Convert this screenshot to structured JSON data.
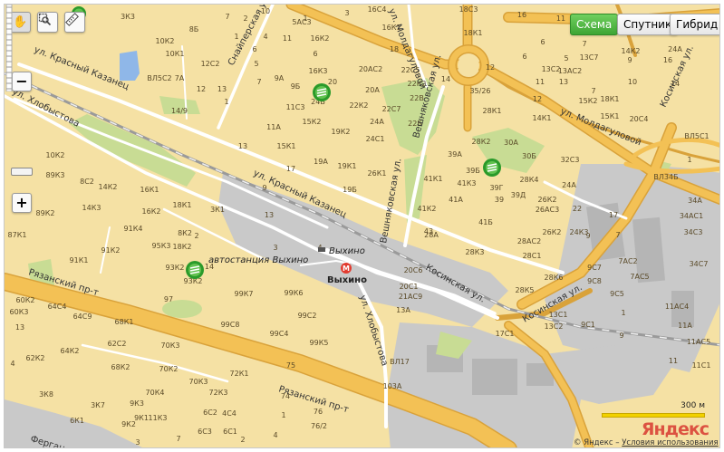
{
  "map_type_buttons": {
    "scheme": "Схема",
    "satellite": "Спутник",
    "hybrid": "Гибрид"
  },
  "toolbar": {
    "pan": "hand-icon",
    "magnifier": "magnifier-icon",
    "ruler": "ruler-icon"
  },
  "zoom": {
    "plus": "+",
    "minus": "−",
    "level_fraction": 0.17
  },
  "streets": {
    "sniperskaya": "Снайперская ул.",
    "moldagulovoy_top": "ул. Молдагуловой",
    "veshnyakovskaya_top": "Вешняковская ул.",
    "krasny_kazanets_upper": "ул. Красный Казанец",
    "khlobystova_upper": "ул. Хлобыстова",
    "moldagulovoy_right": "ул. Молдагуловой",
    "krasny_kazanets_mid": "ул. Красный Казанец",
    "veshnyakovskaya_mid": "Вешняковская ул.",
    "kosinskaya_mid": "Косинская ул.",
    "kosinskaya_right": "Косинская ул.",
    "kosinskaya_far": "Косинская ул.",
    "ryazansky_upper": "Рязанский пр-т",
    "ryazansky_lower": "Рязанский пр-т",
    "khlobystova_lower": "ул. Хлобыстова",
    "fergansky": "Ферган"
  },
  "places": {
    "bus_station": "автостанция Выхино",
    "metro_station": "Выхино",
    "rail_station": "Выхино"
  },
  "scale": {
    "label": "300 м"
  },
  "logo": "Яндекс",
  "copyright": {
    "prefix": "© Яндекс – ",
    "terms_link": "Условия использования"
  },
  "colors": {
    "base": "#f5e1a4",
    "major_road": "#f3c155",
    "road_casing": "#d9a23a",
    "minor_road": "#ffffff",
    "park": "#c8dc94",
    "water": "#8fb7e8",
    "industrial": "#c8c8c8",
    "railway": "#9a9a9a",
    "active_button": "#3fa534"
  },
  "house_numbers": [
    [
      "3К3",
      140,
      20
    ],
    [
      "7",
      250,
      20
    ],
    [
      "10",
      292,
      14
    ],
    [
      "2",
      270,
      22
    ],
    [
      "1",
      336,
      22
    ],
    [
      "5АС3",
      332,
      26
    ],
    [
      "3",
      382,
      16
    ],
    [
      "16С4",
      415,
      12
    ],
    [
      "18С3",
      516,
      12
    ],
    [
      "16",
      575,
      18
    ],
    [
      "11",
      618,
      22
    ],
    [
      "10К2",
      181,
      47
    ],
    [
      "8Б",
      213,
      34
    ],
    [
      "1",
      260,
      42
    ],
    [
      "4",
      292,
      42
    ],
    [
      "6",
      280,
      56
    ],
    [
      "11",
      316,
      44
    ],
    [
      "16К2",
      352,
      44
    ],
    [
      "16К1",
      431,
      32
    ],
    [
      "18К1",
      521,
      38
    ],
    [
      "7",
      644,
      50
    ],
    [
      "6",
      598,
      48
    ],
    [
      "14К2",
      695,
      58
    ],
    [
      "24А",
      744,
      56
    ],
    [
      "10К1",
      192,
      61
    ],
    [
      "12С2",
      231,
      72
    ],
    [
      "5",
      282,
      72
    ],
    [
      "6",
      347,
      61
    ],
    [
      "18",
      434,
      56
    ],
    [
      "6",
      578,
      64
    ],
    [
      "5",
      624,
      66
    ],
    [
      "13С2",
      607,
      78
    ],
    [
      "13АС2",
      628,
      80
    ],
    [
      "13С7",
      649,
      65
    ],
    [
      "9",
      694,
      68
    ],
    [
      "16",
      736,
      68
    ],
    [
      "ВЛ5С2",
      175,
      88
    ],
    [
      "7А",
      197,
      88
    ],
    [
      "7",
      285,
      92
    ],
    [
      "9А",
      307,
      88
    ],
    [
      "16К3",
      350,
      80
    ],
    [
      "20АС2",
      408,
      78
    ],
    [
      "22С5",
      452,
      79
    ],
    [
      "12",
      540,
      76
    ],
    [
      "11",
      595,
      92
    ],
    [
      "13",
      621,
      92
    ],
    [
      "10",
      697,
      92
    ],
    [
      "14",
      744,
      94
    ],
    [
      "12",
      221,
      100
    ],
    [
      "13",
      244,
      100
    ],
    [
      "9Б",
      325,
      97
    ],
    [
      "20",
      366,
      92
    ],
    [
      "22К2",
      459,
      94
    ],
    [
      "14",
      491,
      89
    ],
    [
      "35/26",
      529,
      102
    ],
    [
      "12",
      592,
      111
    ],
    [
      "7",
      654,
      102
    ],
    [
      "14/9",
      197,
      124
    ],
    [
      "1",
      249,
      114
    ],
    [
      "11С3",
      325,
      120
    ],
    [
      "24Б",
      350,
      114
    ],
    [
      "22К2",
      395,
      118
    ],
    [
      "20А",
      410,
      101
    ],
    [
      "22С7",
      431,
      122
    ],
    [
      "22В",
      459,
      110
    ],
    [
      "28К1",
      542,
      124
    ],
    [
      "15К2",
      648,
      113
    ],
    [
      "18К1",
      672,
      111
    ],
    [
      "11А",
      301,
      142
    ],
    [
      "15К2",
      343,
      136
    ],
    [
      "19К2",
      375,
      147
    ],
    [
      "24А",
      415,
      136
    ],
    [
      "22Б",
      457,
      138
    ],
    [
      "14К1",
      597,
      132
    ],
    [
      "15К1",
      672,
      130
    ],
    [
      "20С4",
      704,
      133
    ],
    [
      "13",
      267,
      163
    ],
    [
      "15К1",
      315,
      163
    ],
    [
      "24С1",
      413,
      155
    ],
    [
      "28К2",
      530,
      158
    ],
    [
      "30А",
      563,
      159
    ],
    [
      "ВЛ5С1",
      768,
      152
    ],
    [
      "1",
      760,
      178
    ],
    [
      "19А",
      353,
      180
    ],
    [
      "19К1",
      382,
      185
    ],
    [
      "26К1",
      415,
      193
    ],
    [
      "39А",
      501,
      172
    ],
    [
      "30Б",
      583,
      174
    ],
    [
      "32С3",
      628,
      178
    ],
    [
      "17",
      320,
      188
    ],
    [
      "39Б",
      521,
      190
    ],
    [
      "39Г",
      547,
      209
    ],
    [
      "28К4",
      583,
      200
    ],
    [
      "24А",
      627,
      206
    ],
    [
      "ВЛ34Б",
      734,
      197
    ],
    [
      "34А",
      766,
      223
    ],
    [
      "10К2",
      60,
      173
    ],
    [
      "89К3",
      60,
      195
    ],
    [
      "8С2",
      95,
      202
    ],
    [
      "14К2",
      118,
      208
    ],
    [
      "16К1",
      164,
      211
    ],
    [
      "9",
      291,
      209
    ],
    [
      "19Б",
      385,
      211
    ],
    [
      "41К1",
      477,
      199
    ],
    [
      "41К3",
      514,
      204
    ],
    [
      "39Д",
      571,
      217
    ],
    [
      "41А",
      502,
      222
    ],
    [
      "39",
      550,
      222
    ],
    [
      "26К2",
      603,
      222
    ],
    [
      "26АС3",
      603,
      233
    ],
    [
      "22",
      636,
      232
    ],
    [
      "34АС1",
      762,
      240
    ],
    [
      "14К3",
      100,
      231
    ],
    [
      "18К1",
      200,
      228
    ],
    [
      "3К1",
      239,
      233
    ],
    [
      "41К2",
      470,
      232
    ],
    [
      "41Б",
      535,
      247
    ],
    [
      "17",
      676,
      239
    ],
    [
      "16К2",
      166,
      235
    ],
    [
      "89К2",
      49,
      237
    ],
    [
      "13",
      296,
      239
    ],
    [
      "7",
      681,
      261
    ],
    [
      "9",
      648,
      262
    ],
    [
      "34С3",
      764,
      258
    ],
    [
      "87К1",
      18,
      261
    ],
    [
      "91К4",
      146,
      254
    ],
    [
      "95К3",
      177,
      273
    ],
    [
      "8К2",
      203,
      259
    ],
    [
      "2",
      216,
      262
    ],
    [
      "28А",
      475,
      261
    ],
    [
      "26К2",
      608,
      258
    ],
    [
      "24К3",
      638,
      258
    ],
    [
      "91К1",
      86,
      289
    ],
    [
      "91К2",
      121,
      278
    ],
    [
      "18К2",
      200,
      274
    ],
    [
      "3",
      303,
      275
    ],
    [
      "4",
      352,
      275
    ],
    [
      "43",
      472,
      257
    ],
    [
      "28К3",
      523,
      280
    ],
    [
      "28АС2",
      583,
      268
    ],
    [
      "28С1",
      586,
      284
    ],
    [
      "7АС2",
      692,
      290
    ],
    [
      "34С7",
      770,
      293
    ],
    [
      "93К2",
      192,
      297
    ],
    [
      "14",
      230,
      296
    ],
    [
      "20С6",
      455,
      300
    ],
    [
      "20С1",
      450,
      318
    ],
    [
      "7АС5",
      705,
      307
    ],
    [
      "9С7",
      655,
      297
    ],
    [
      "9С8",
      655,
      312
    ],
    [
      "97",
      185,
      332
    ],
    [
      "93К2",
      212,
      312
    ],
    [
      "99К7",
      268,
      326
    ],
    [
      "99К6",
      323,
      325
    ],
    [
      "21АС9",
      452,
      329
    ],
    [
      "28К5",
      578,
      322
    ],
    [
      "28К6",
      610,
      308
    ],
    [
      "9С5",
      680,
      326
    ],
    [
      "60К2",
      27,
      333
    ],
    [
      "64С4",
      62,
      340
    ],
    [
      "60К3",
      20,
      346
    ],
    [
      "64С9",
      90,
      351
    ],
    [
      "68К1",
      136,
      357
    ],
    [
      "13А",
      444,
      344
    ],
    [
      "13С1",
      615,
      349
    ],
    [
      "9С1",
      648,
      360
    ],
    [
      "1",
      687,
      347
    ],
    [
      "11АС4",
      746,
      340
    ],
    [
      "13",
      21,
      363
    ],
    [
      "99С8",
      253,
      360
    ],
    [
      "99С2",
      338,
      350
    ],
    [
      "11А",
      755,
      361
    ],
    [
      "11АС5",
      770,
      379
    ],
    [
      "62С2",
      128,
      381
    ],
    [
      "99С4",
      307,
      370
    ],
    [
      "99К5",
      351,
      380
    ],
    [
      "17С1",
      556,
      370
    ],
    [
      "62К2",
      38,
      397
    ],
    [
      "64К2",
      76,
      389
    ],
    [
      "70К3",
      187,
      383
    ],
    [
      "13С2",
      610,
      362
    ],
    [
      "9",
      685,
      372
    ],
    [
      "4",
      13,
      403
    ],
    [
      "68К2",
      132,
      407
    ],
    [
      "70К2",
      185,
      409
    ],
    [
      "72К1",
      263,
      414
    ],
    [
      "ВЛ17",
      440,
      401
    ],
    [
      "75",
      320,
      405
    ],
    [
      "11С1",
      773,
      405
    ],
    [
      "11",
      742,
      400
    ],
    [
      "70К3",
      218,
      423
    ],
    [
      "103А",
      432,
      428
    ],
    [
      "3К8",
      50,
      437
    ],
    [
      "9К3",
      150,
      447
    ],
    [
      "70К4",
      170,
      435
    ],
    [
      "72К3",
      240,
      435
    ],
    [
      "3К7",
      107,
      449
    ],
    [
      "9К1",
      155,
      463
    ],
    [
      "11К3",
      173,
      463
    ],
    [
      "4С4",
      252,
      458
    ],
    [
      "6С2",
      231,
      457
    ],
    [
      "74",
      314,
      439
    ],
    [
      "76/2",
      351,
      472
    ],
    [
      "6К1",
      84,
      466
    ],
    [
      "9К2",
      141,
      470
    ],
    [
      "1",
      312,
      460
    ],
    [
      "76",
      350,
      456
    ],
    [
      "2",
      267,
      487
    ],
    [
      "3",
      151,
      490
    ],
    [
      "7",
      196,
      486
    ],
    [
      "6С3",
      225,
      478
    ],
    [
      "6С1",
      253,
      478
    ],
    [
      "4",
      303,
      482
    ]
  ]
}
